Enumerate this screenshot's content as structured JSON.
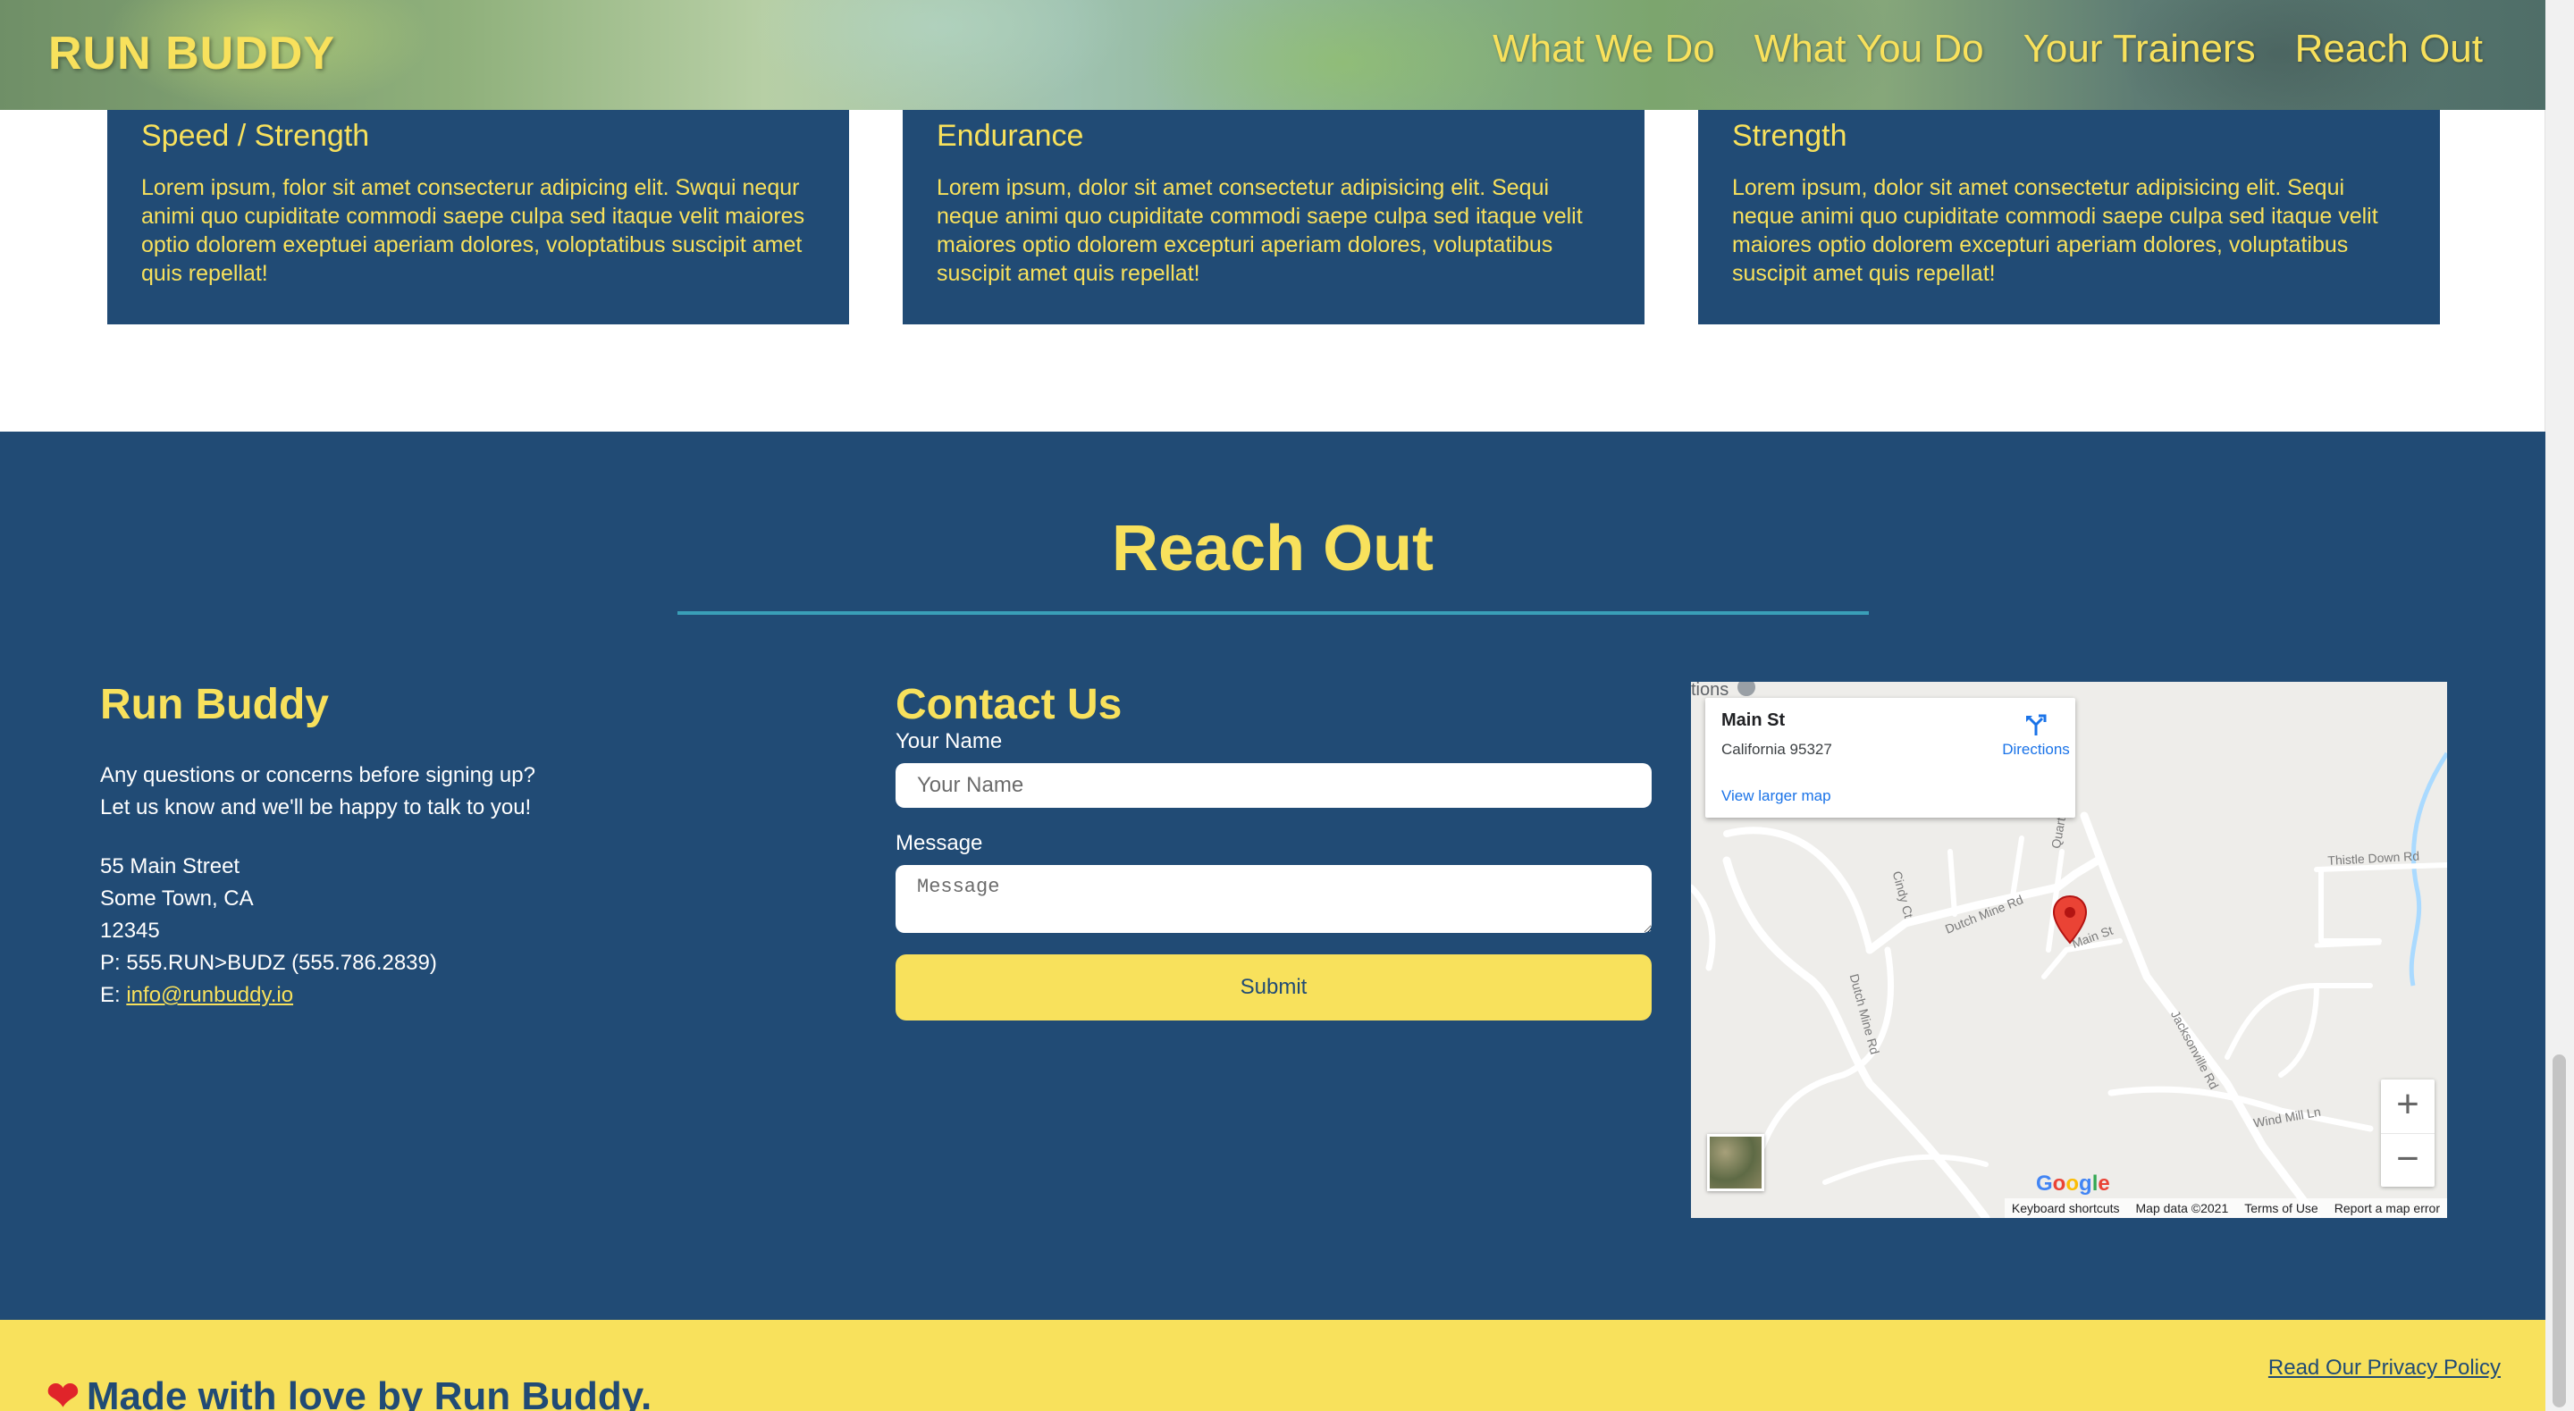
{
  "header": {
    "logo": "RUN BUDDY",
    "nav": [
      "What We Do",
      "What You Do",
      "Your Trainers",
      "Reach Out"
    ]
  },
  "cards": [
    {
      "subtitle": "Speed / Strength",
      "text": "Lorem ipsum, folor sit amet consecterur adipicing elit. Swqui nequr animi quo cupiditate commodi saepe culpa sed itaque velit maiores optio dolorem exeptuei aperiam dolores, voloptatibus suscipit amet quis repellat!"
    },
    {
      "subtitle": "Endurance",
      "text": "Lorem ipsum, dolor sit amet consectetur adipisicing elit. Sequi neque animi quo cupiditate commodi saepe culpa sed itaque velit maiores optio dolorem excepturi aperiam dolores, voluptatibus suscipit amet quis repellat!"
    },
    {
      "subtitle": "Strength",
      "text": "Lorem ipsum, dolor sit amet consectetur adipisicing elit. Sequi neque animi quo cupiditate commodi saepe culpa sed itaque velit maiores optio dolorem excepturi aperiam dolores, voluptatibus suscipit amet quis repellat!"
    }
  ],
  "reach": {
    "title": "Reach Out",
    "about": {
      "title": "Run Buddy",
      "blurb_line1": "Any questions or concerns before signing up?",
      "blurb_line2": "Let us know and we'll be happy to talk to you!",
      "street": "55 Main Street",
      "city": "Some Town, CA",
      "zip": "12345",
      "phone": "P: 555.RUN>BUDZ (555.786.2839)",
      "email_prefix": "E: ",
      "email": "info@runbuddy.io"
    },
    "contact": {
      "title": "Contact Us",
      "name_label": "Your Name",
      "name_placeholder": "Your Name",
      "message_label": "Message",
      "message_placeholder": "Message",
      "submit_label": "Submit"
    },
    "map": {
      "fragment": "tions",
      "place": "Main St",
      "address": "California 95327",
      "directions": "Directions",
      "larger": "View larger map",
      "roads": [
        "Cindy Ct",
        "Quartz St",
        "Dutch Mine Rd",
        "Main St",
        "Dutch Mine Rd",
        "Jacksonville Rd",
        "Thistle Down Rd",
        "Wind Mill Ln"
      ],
      "zoom_in": "+",
      "zoom_out": "−",
      "google": [
        "G",
        "o",
        "o",
        "g",
        "l",
        "e"
      ],
      "footer": [
        "Keyboard shortcuts",
        "Map data ©2021",
        "Terms of Use",
        "Report a map error"
      ]
    }
  },
  "footer": {
    "love": "Made with love by Run Buddy.",
    "privacy": "Read Our Privacy Policy"
  },
  "colors": {
    "navy": "#214b75",
    "yellow": "#f8e15c",
    "teal_rule": "#3a9fb8",
    "pin_red": "#ea4335"
  }
}
